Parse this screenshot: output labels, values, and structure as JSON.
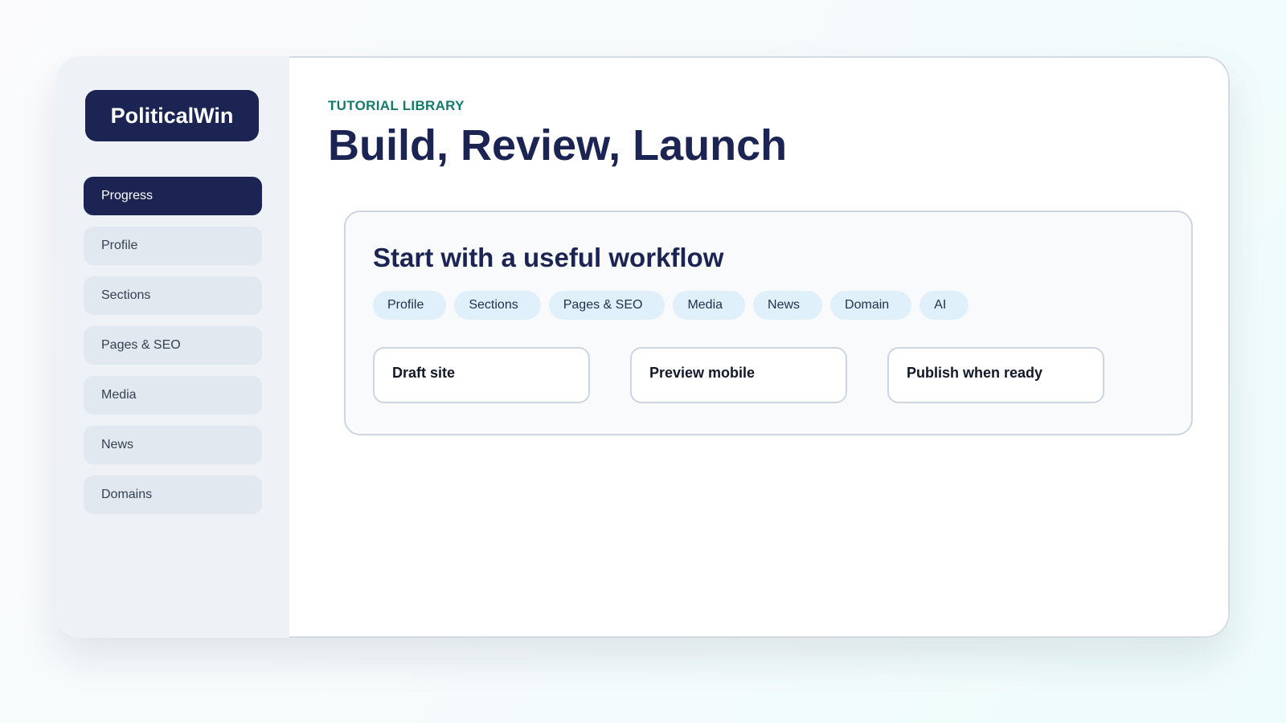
{
  "brand": {
    "name": "PoliticalWin"
  },
  "sidebar": {
    "items": [
      {
        "label": "Progress",
        "active": true
      },
      {
        "label": "Profile",
        "active": false
      },
      {
        "label": "Sections",
        "active": false
      },
      {
        "label": "Pages & SEO",
        "active": false
      },
      {
        "label": "Media",
        "active": false
      },
      {
        "label": "News",
        "active": false
      },
      {
        "label": "Domains",
        "active": false
      }
    ]
  },
  "header": {
    "eyebrow": "TUTORIAL LIBRARY",
    "title": "Build, Review, Launch"
  },
  "workflow": {
    "title": "Start with a useful workflow",
    "chips": [
      "Profile",
      "Sections",
      "Pages & SEO",
      "Media",
      "News",
      "Domain",
      "AI"
    ],
    "steps": [
      "Draft site",
      "Preview mobile",
      "Publish when ready"
    ]
  },
  "colors": {
    "brand_navy": "#1b2452",
    "accent_teal": "#157a6e",
    "chip_bg": "#e0f0fb",
    "nav_bg": "#e2e8f0"
  }
}
